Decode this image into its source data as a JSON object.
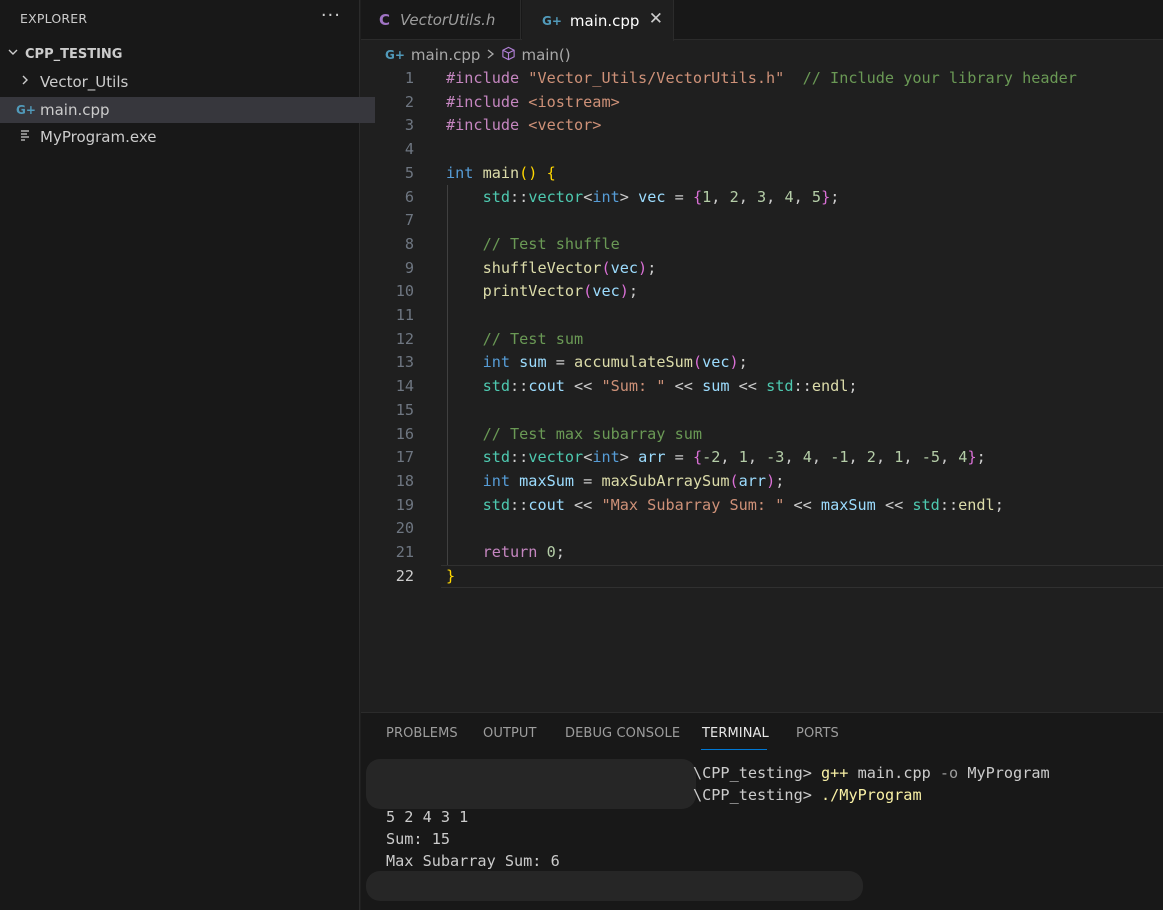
{
  "sidebar": {
    "title": "EXPLORER",
    "more": "···",
    "folder": "CPP_TESTING",
    "items": [
      {
        "label": "Vector_Utils"
      },
      {
        "label": "main.cpp"
      },
      {
        "label": "MyProgram.exe"
      }
    ]
  },
  "tabs": [
    {
      "label": "VectorUtils.h",
      "icon": "C"
    },
    {
      "label": "main.cpp"
    }
  ],
  "breadcrumb": {
    "file": "main.cpp",
    "symbol": "main()"
  },
  "editor": {
    "line_numbers": [
      "1",
      "2",
      "3",
      "4",
      "5",
      "6",
      "7",
      "8",
      "9",
      "10",
      "11",
      "12",
      "13",
      "14",
      "15",
      "16",
      "17",
      "18",
      "19",
      "20",
      "21",
      "22"
    ],
    "active_line": "22",
    "lines": [
      [
        {
          "t": "#include ",
          "c": "pre"
        },
        {
          "t": "\"Vector_Utils/VectorUtils.h\"",
          "c": "str"
        },
        {
          "t": "  // Include your library header",
          "c": "com"
        }
      ],
      [
        {
          "t": "#include ",
          "c": "pre"
        },
        {
          "t": "<iostream>",
          "c": "str"
        }
      ],
      [
        {
          "t": "#include ",
          "c": "pre"
        },
        {
          "t": "<vector>",
          "c": "str"
        }
      ],
      [],
      [
        {
          "t": "int ",
          "c": "type"
        },
        {
          "t": "main",
          "c": "fn"
        },
        {
          "t": "()",
          "c": "b1"
        },
        {
          "t": " "
        },
        {
          "t": "{",
          "c": "b1"
        }
      ],
      [
        {
          "t": "    "
        },
        {
          "t": "std",
          "c": "ns"
        },
        {
          "t": "::"
        },
        {
          "t": "vector",
          "c": "ns"
        },
        {
          "t": "<"
        },
        {
          "t": "int",
          "c": "type"
        },
        {
          "t": "> "
        },
        {
          "t": "vec",
          "c": "var"
        },
        {
          "t": " = "
        },
        {
          "t": "{",
          "c": "b2"
        },
        {
          "t": "1",
          "c": "num"
        },
        {
          "t": ", "
        },
        {
          "t": "2",
          "c": "num"
        },
        {
          "t": ", "
        },
        {
          "t": "3",
          "c": "num"
        },
        {
          "t": ", "
        },
        {
          "t": "4",
          "c": "num"
        },
        {
          "t": ", "
        },
        {
          "t": "5",
          "c": "num"
        },
        {
          "t": "}",
          "c": "b2"
        },
        {
          "t": ";"
        }
      ],
      [],
      [
        {
          "t": "    "
        },
        {
          "t": "// Test shuffle",
          "c": "com"
        }
      ],
      [
        {
          "t": "    "
        },
        {
          "t": "shuffleVector",
          "c": "fn"
        },
        {
          "t": "(",
          "c": "b2"
        },
        {
          "t": "vec",
          "c": "var"
        },
        {
          "t": ")",
          "c": "b2"
        },
        {
          "t": ";"
        }
      ],
      [
        {
          "t": "    "
        },
        {
          "t": "printVector",
          "c": "fn"
        },
        {
          "t": "(",
          "c": "b2"
        },
        {
          "t": "vec",
          "c": "var"
        },
        {
          "t": ")",
          "c": "b2"
        },
        {
          "t": ";"
        }
      ],
      [],
      [
        {
          "t": "    "
        },
        {
          "t": "// Test sum",
          "c": "com"
        }
      ],
      [
        {
          "t": "    "
        },
        {
          "t": "int ",
          "c": "type"
        },
        {
          "t": "sum",
          "c": "var"
        },
        {
          "t": " = "
        },
        {
          "t": "accumulateSum",
          "c": "fn"
        },
        {
          "t": "(",
          "c": "b2"
        },
        {
          "t": "vec",
          "c": "var"
        },
        {
          "t": ")",
          "c": "b2"
        },
        {
          "t": ";"
        }
      ],
      [
        {
          "t": "    "
        },
        {
          "t": "std",
          "c": "ns"
        },
        {
          "t": "::"
        },
        {
          "t": "cout",
          "c": "var"
        },
        {
          "t": " << "
        },
        {
          "t": "\"Sum: \"",
          "c": "str"
        },
        {
          "t": " << "
        },
        {
          "t": "sum",
          "c": "var"
        },
        {
          "t": " << "
        },
        {
          "t": "std",
          "c": "ns"
        },
        {
          "t": "::"
        },
        {
          "t": "endl",
          "c": "fn"
        },
        {
          "t": ";"
        }
      ],
      [],
      [
        {
          "t": "    "
        },
        {
          "t": "// Test max subarray sum",
          "c": "com"
        }
      ],
      [
        {
          "t": "    "
        },
        {
          "t": "std",
          "c": "ns"
        },
        {
          "t": "::"
        },
        {
          "t": "vector",
          "c": "ns"
        },
        {
          "t": "<"
        },
        {
          "t": "int",
          "c": "type"
        },
        {
          "t": "> "
        },
        {
          "t": "arr",
          "c": "var"
        },
        {
          "t": " = "
        },
        {
          "t": "{",
          "c": "b2"
        },
        {
          "t": "-2",
          "c": "num"
        },
        {
          "t": ", "
        },
        {
          "t": "1",
          "c": "num"
        },
        {
          "t": ", "
        },
        {
          "t": "-3",
          "c": "num"
        },
        {
          "t": ", "
        },
        {
          "t": "4",
          "c": "num"
        },
        {
          "t": ", "
        },
        {
          "t": "-1",
          "c": "num"
        },
        {
          "t": ", "
        },
        {
          "t": "2",
          "c": "num"
        },
        {
          "t": ", "
        },
        {
          "t": "1",
          "c": "num"
        },
        {
          "t": ", "
        },
        {
          "t": "-5",
          "c": "num"
        },
        {
          "t": ", "
        },
        {
          "t": "4",
          "c": "num"
        },
        {
          "t": "}",
          "c": "b2"
        },
        {
          "t": ";"
        }
      ],
      [
        {
          "t": "    "
        },
        {
          "t": "int ",
          "c": "type"
        },
        {
          "t": "maxSum",
          "c": "var"
        },
        {
          "t": " = "
        },
        {
          "t": "maxSubArraySum",
          "c": "fn"
        },
        {
          "t": "(",
          "c": "b2"
        },
        {
          "t": "arr",
          "c": "var"
        },
        {
          "t": ")",
          "c": "b2"
        },
        {
          "t": ";"
        }
      ],
      [
        {
          "t": "    "
        },
        {
          "t": "std",
          "c": "ns"
        },
        {
          "t": "::"
        },
        {
          "t": "cout",
          "c": "var"
        },
        {
          "t": " << "
        },
        {
          "t": "\"Max Subarray Sum: \"",
          "c": "str"
        },
        {
          "t": " << "
        },
        {
          "t": "maxSum",
          "c": "var"
        },
        {
          "t": " << "
        },
        {
          "t": "std",
          "c": "ns"
        },
        {
          "t": "::"
        },
        {
          "t": "endl",
          "c": "fn"
        },
        {
          "t": ";"
        }
      ],
      [],
      [
        {
          "t": "    "
        },
        {
          "t": "return ",
          "c": "kw"
        },
        {
          "t": "0",
          "c": "num"
        },
        {
          "t": ";"
        }
      ],
      [
        {
          "t": "}",
          "c": "b1"
        }
      ]
    ]
  },
  "panel": {
    "tabs": [
      "PROBLEMS",
      "OUTPUT",
      "DEBUG CONSOLE",
      "TERMINAL",
      "PORTS"
    ],
    "active_tab": "TERMINAL",
    "terminal": {
      "prompt1_path": "\\CPP_testing> ",
      "cmd1_prog": "g++",
      "cmd1_arg": " main.cpp ",
      "cmd1_flag": "-o",
      "cmd1_out": " MyProgram",
      "prompt2_path": "\\CPP_testing> ",
      "cmd2": "./MyProgram",
      "output": [
        "5 2 4 3 1",
        "Sum: 15",
        "Max Subarray Sum: 6"
      ]
    }
  },
  "colors": {
    "accent": "#0078d4",
    "cpp_icon": "#519aba",
    "header_icon": "#a074c4"
  }
}
